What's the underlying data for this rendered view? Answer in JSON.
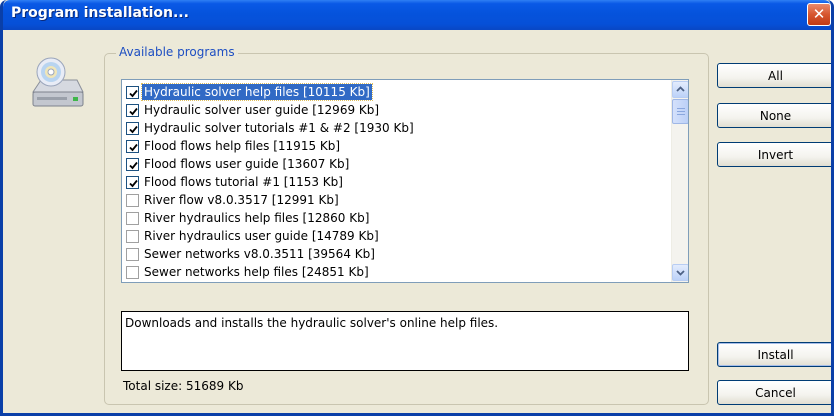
{
  "window": {
    "title": "Program installation..."
  },
  "group": {
    "legend": "Available programs"
  },
  "programs": [
    {
      "label": "Hydraulic solver help files [10115 Kb]",
      "checked": true,
      "selected": true
    },
    {
      "label": "Hydraulic solver user guide [12969 Kb]",
      "checked": true,
      "selected": false
    },
    {
      "label": "Hydraulic solver tutorials #1 & #2 [1930 Kb]",
      "checked": true,
      "selected": false
    },
    {
      "label": "Flood flows help files [11915 Kb]",
      "checked": true,
      "selected": false
    },
    {
      "label": "Flood flows user guide [13607 Kb]",
      "checked": true,
      "selected": false
    },
    {
      "label": "Flood flows tutorial #1 [1153 Kb]",
      "checked": true,
      "selected": false
    },
    {
      "label": "River flow v8.0.3517 [12991 Kb]",
      "checked": false,
      "selected": false
    },
    {
      "label": "River hydraulics help files [12860 Kb]",
      "checked": false,
      "selected": false
    },
    {
      "label": "River hydraulics user guide [14789 Kb]",
      "checked": false,
      "selected": false
    },
    {
      "label": "Sewer networks v8.0.3511 [39564 Kb]",
      "checked": false,
      "selected": false
    },
    {
      "label": "Sewer networks help files [24851 Kb]",
      "checked": false,
      "selected": false
    }
  ],
  "description": "Downloads and installs the hydraulic solver's online help files.",
  "total_size": "Total size: 51689 Kb",
  "buttons": {
    "all": "All",
    "none": "None",
    "invert": "Invert",
    "install": "Install",
    "cancel": "Cancel"
  },
  "icons": {
    "app": "cd-drive-icon",
    "close": "close-icon",
    "scroll_up": "chevron-up-icon",
    "scroll_down": "chevron-down-icon",
    "check": "checkmark-icon"
  },
  "colors": {
    "titlebar": "#0553dc",
    "selection": "#316ac5",
    "legend": "#1d4ec2",
    "dialog_bg": "#ece9d8",
    "close_button": "#d6562f"
  }
}
